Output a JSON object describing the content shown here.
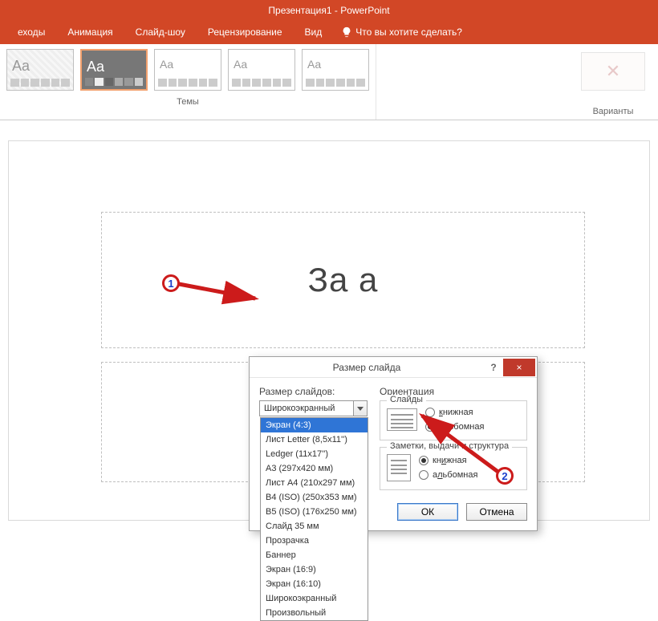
{
  "app": {
    "title": "Презентация1 - PowerPoint"
  },
  "tabs": {
    "transitions": "еходы",
    "animation": "Анимация",
    "slideshow": "Слайд-шоу",
    "review": "Рецензирование",
    "view": "Вид",
    "tellme": "Что вы хотите сделать?"
  },
  "ribbon": {
    "themes_group": "Темы",
    "variants_group": "Варианты"
  },
  "slide": {
    "title_placeholder": "За                        а"
  },
  "dialog": {
    "title": "Размер слайда",
    "help": "?",
    "close": "×",
    "size_label": "Размер слайдов:",
    "combo_value": "Широкоэкранный",
    "options": [
      "Экран (4:3)",
      "Лист Letter (8,5x11'')",
      "Ledger (11x17'')",
      "A3 (297x420 мм)",
      "Лист A4 (210x297 мм)",
      "B4 (ISO) (250x353 мм)",
      "B5 (ISO) (176x250 мм)",
      "Слайд 35 мм",
      "Прозрачка",
      "Баннер",
      "Экран (16:9)",
      "Экран (16:10)",
      "Широкоэкранный",
      "Произвольный"
    ],
    "selected_option_index": 0,
    "orientation": {
      "title": "Ориентация",
      "slides_title": "Слайды",
      "slides_portrait": "книжная",
      "slides_landscape": "альбомная",
      "slides_value": "landscape",
      "notes_title": "Заметки, выдачи и структура",
      "notes_portrait": "книжная",
      "notes_landscape": "альбомная",
      "notes_value": "portrait"
    },
    "ok": "ОК",
    "cancel": "Отмена"
  },
  "annotations": {
    "n1": "1",
    "n2": "2"
  }
}
